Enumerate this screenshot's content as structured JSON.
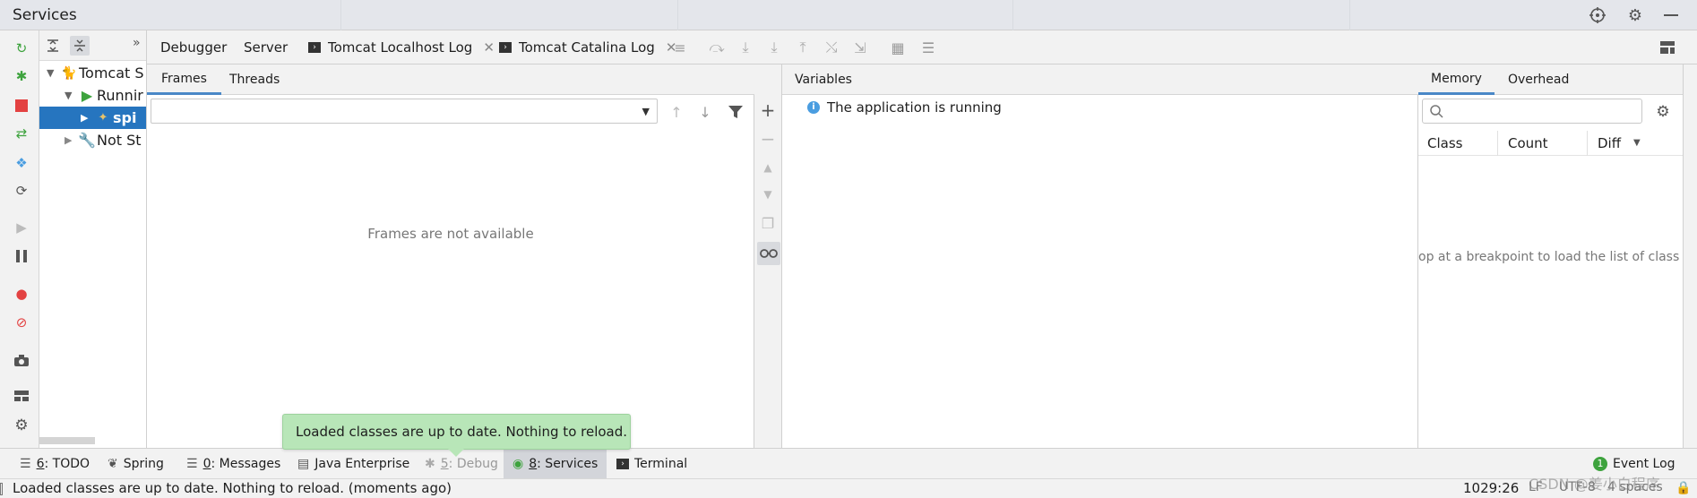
{
  "window": {
    "title": "Services"
  },
  "tree": {
    "rows": [
      {
        "label": "Tomcat S"
      },
      {
        "label": "Runnir"
      },
      {
        "label": "spi"
      },
      {
        "label": "Not St"
      }
    ]
  },
  "tabs": {
    "debugger": "Debugger",
    "server": "Server",
    "localhost_log": "Tomcat Localhost Log",
    "catalina_log": "Tomcat Catalina Log"
  },
  "frames": {
    "tab_frames": "Frames",
    "tab_threads": "Threads",
    "empty_text": "Frames are not available"
  },
  "variables": {
    "header": "Variables",
    "running_message": "The application is running"
  },
  "memory": {
    "tab_memory": "Memory",
    "tab_overhead": "Overhead",
    "search_placeholder": "",
    "col_class": "Class",
    "col_count": "Count",
    "col_diff": "Diff",
    "empty_text": "op at a breakpoint to load the list of class"
  },
  "toast": {
    "message": "Loaded classes are up to date. Nothing to reload."
  },
  "tool_windows": {
    "todo_num": "6",
    "todo_label": ": TODO",
    "spring": "Spring",
    "messages_num": "0",
    "messages_label": ": Messages",
    "java_enterprise": "Java Enterprise",
    "debug_num": "5",
    "debug_label": ": Debug",
    "services_num": "8",
    "services_label": ": Services",
    "terminal": "Terminal",
    "event_log_badge": "1",
    "event_log": "Event Log"
  },
  "status": {
    "message": "Loaded classes are up to date. Nothing to reload. (moments ago)",
    "position": "1029:26",
    "line_sep": "LF",
    "encoding": "UTF-8",
    "indent": "4 spaces",
    "watermark": "CSDN @姜小白程序"
  },
  "colors": {
    "accent": "#2675bf",
    "toast_bg": "#b8e6b8",
    "run_green": "#3ea33e",
    "stop_red": "#e34242",
    "info_blue": "#4a9de0"
  }
}
